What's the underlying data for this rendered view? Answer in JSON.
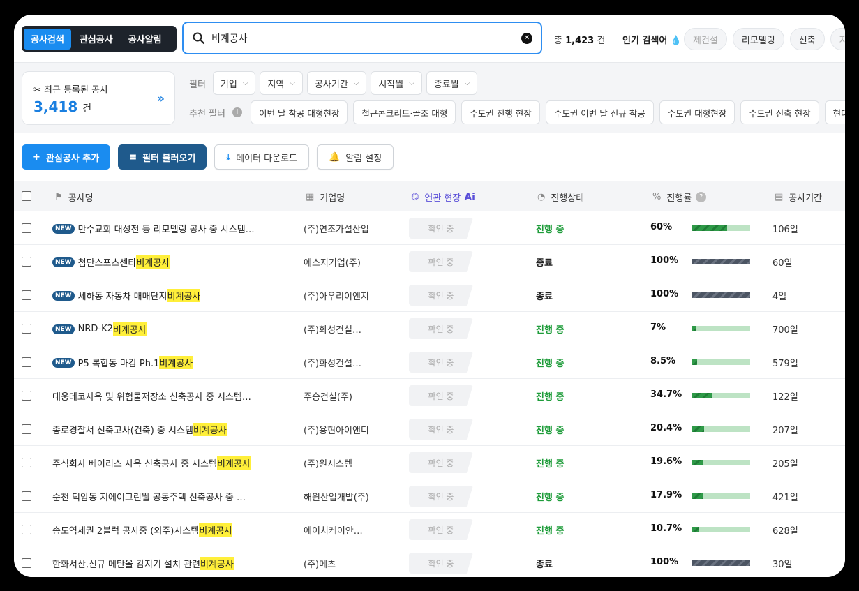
{
  "tabs": [
    "공사검색",
    "관심공사",
    "공사알림"
  ],
  "search": {
    "value": "비계공사"
  },
  "total": {
    "prefix": "총",
    "count": "1,423",
    "suffix": "건"
  },
  "popular": {
    "label": "인기 검색어",
    "chips": [
      "제건설",
      "리모델링",
      "신축",
      "지역"
    ]
  },
  "recent": {
    "label": "최근 등록된 공사",
    "count": "3,418",
    "unit": "건"
  },
  "filter": {
    "label": "필터",
    "items": [
      "기업",
      "지역",
      "공사기간",
      "시작월",
      "종료월"
    ]
  },
  "recommend": {
    "label": "추천 필터",
    "items": [
      "이번 달 착공 대형현장",
      "철근콘크리트·골조 대형",
      "수도권 진행 현장",
      "수도권 이번 달 신규 착공",
      "수도권 대형현장",
      "수도권 신축 현장",
      "현대"
    ]
  },
  "actions": {
    "add": "관심공사 추가",
    "load": "필터 불러오기",
    "download": "데이터 다운로드",
    "alert": "알림 설정"
  },
  "columns": {
    "name": "공사명",
    "company": "기업명",
    "related": "연관 현장",
    "related_ai": "Ai",
    "status": "진행상태",
    "progress": "진행률",
    "period": "공사기간"
  },
  "rows": [
    {
      "new": true,
      "name": "만수교회 대성전 등 리모델링 공사 중 시스템…",
      "highlight": "",
      "company": "(주)연조가설산업",
      "confirm": "확인 중",
      "status": "진행 중",
      "done": false,
      "pct": "60%",
      "progress": 0.6,
      "period": "106일"
    },
    {
      "new": true,
      "name": "첨단스포츠센타 ",
      "highlight": "비계공사",
      "company": "에스지기업(주)",
      "confirm": "확인 중",
      "status": "종료",
      "done": true,
      "pct": "100%",
      "progress": 1.0,
      "period": "60일"
    },
    {
      "new": true,
      "name": "세하동 자동차 매매단지 ",
      "highlight": "비계공사",
      "company": "(주)아우리이엔지",
      "confirm": "확인 중",
      "status": "종료",
      "done": true,
      "pct": "100%",
      "progress": 1.0,
      "period": "4일"
    },
    {
      "new": true,
      "name": "NRD-K2 ",
      "highlight": "비계공사",
      "company": "(주)화성건설…",
      "confirm": "확인 중",
      "status": "진행 중",
      "done": false,
      "pct": "7%",
      "progress": 0.07,
      "period": "700일"
    },
    {
      "new": true,
      "name": "P5 복합동 마감 Ph.1 ",
      "highlight": "비계공사",
      "company": "(주)화성건설…",
      "confirm": "확인 중",
      "status": "진행 중",
      "done": false,
      "pct": "8.5%",
      "progress": 0.085,
      "period": "579일"
    },
    {
      "new": false,
      "name": "대웅데코사옥 및 위험물저장소 신축공사 중 시스템…",
      "highlight": "",
      "company": "주승건설(주)",
      "confirm": "확인 중",
      "status": "진행 중",
      "done": false,
      "pct": "34.7%",
      "progress": 0.347,
      "period": "122일"
    },
    {
      "new": false,
      "name": "종로경찰서 신축고사(건축) 중 시스템",
      "highlight": "비계공사",
      "company": "(주)용현아이앤디",
      "confirm": "확인 중",
      "status": "진행 중",
      "done": false,
      "pct": "20.4%",
      "progress": 0.204,
      "period": "207일"
    },
    {
      "new": false,
      "name": "주식회사 베이리스 사옥 신축공사 중 시스템",
      "highlight": "비계공사",
      "company": "(주)원시스템",
      "confirm": "확인 중",
      "status": "진행 중",
      "done": false,
      "pct": "19.6%",
      "progress": 0.196,
      "period": "205일"
    },
    {
      "new": false,
      "name": "순천 덕암동 지에이그린웰 공동주택 신축공사 중 …",
      "highlight": "",
      "company": "해원산업개발(주)",
      "confirm": "확인 중",
      "status": "진행 중",
      "done": false,
      "pct": "17.9%",
      "progress": 0.179,
      "period": "421일"
    },
    {
      "new": false,
      "name": "송도역세권 2블럭 공사중 (외주)시스템",
      "highlight": "비계공사",
      "company": "에이치케이안…",
      "confirm": "확인 중",
      "status": "진행 중",
      "done": false,
      "pct": "10.7%",
      "progress": 0.107,
      "period": "628일"
    },
    {
      "new": false,
      "name": "한화서산,신규 메탄올 감지기 설치 관련 ",
      "highlight": "비계공사",
      "company": "(주)메츠",
      "confirm": "확인 중",
      "status": "종료",
      "done": true,
      "pct": "100%",
      "progress": 1.0,
      "period": "30일"
    }
  ]
}
